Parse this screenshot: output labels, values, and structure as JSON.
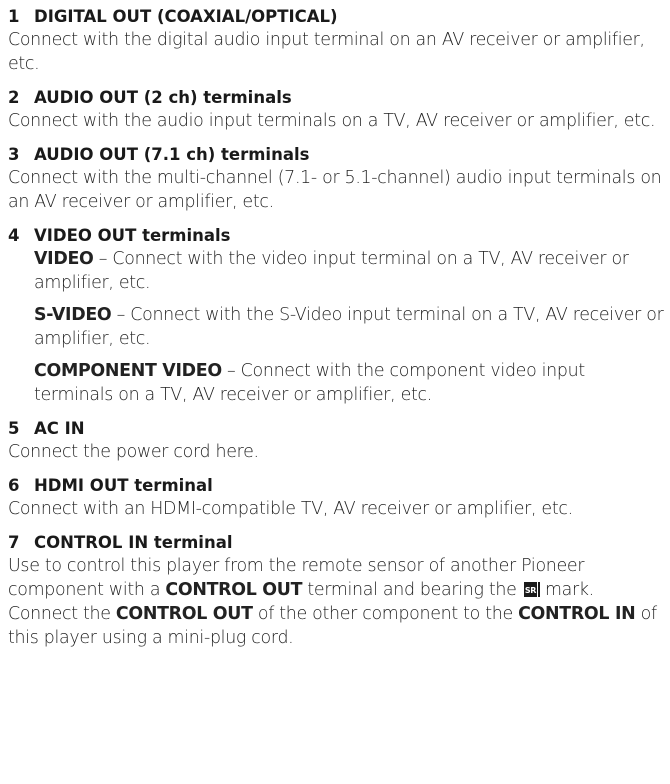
{
  "items": [
    {
      "number": "1",
      "title": "DIGITAL OUT (COAXIAL/OPTICAL)",
      "text": "Connect with the digital audio input terminal on an AV receiver or amplifier, etc."
    },
    {
      "number": "2",
      "title": "AUDIO OUT (2 ch) terminals",
      "text": "Connect with the audio input terminals on a TV, AV receiver or amplifier, etc."
    },
    {
      "number": "3",
      "title": "AUDIO OUT (7.1 ch) terminals",
      "text": "Connect with the multi-channel (7.1- or 5.1-channel) audio input terminals on an AV receiver or amplifier, etc."
    },
    {
      "number": "4",
      "title": "VIDEO OUT terminals",
      "subitems": [
        {
          "label": "VIDEO",
          "text": " – Connect with the video input terminal on a TV, AV receiver or amplifier, etc."
        },
        {
          "label": "S-VIDEO",
          "text": " – Connect with the S-Video input terminal on a TV, AV receiver or amplifier, etc."
        },
        {
          "label": "COMPONENT VIDEO",
          "text": " – Connect with the component video input terminals on a TV, AV receiver or amplifier, etc."
        }
      ]
    },
    {
      "number": "5",
      "title": "AC IN",
      "text": "Connect the power cord here."
    },
    {
      "number": "6",
      "title": "HDMI OUT terminal",
      "text": "Connect with an HDMI-compatible TV, AV receiver or amplifier, etc."
    },
    {
      "number": "7",
      "title": "CONTROL IN terminal",
      "text_parts": [
        "Use to control this player from the remote sensor of another Pioneer component with a ",
        "CONTROL OUT",
        " terminal and bearing the ",
        " mark. Connect the ",
        "CONTROL OUT",
        " of the other component to the ",
        "CONTROL IN",
        " of this player using a mini-plug cord."
      ]
    }
  ],
  "icons": {
    "sr_mark": "sr-logo-icon"
  }
}
